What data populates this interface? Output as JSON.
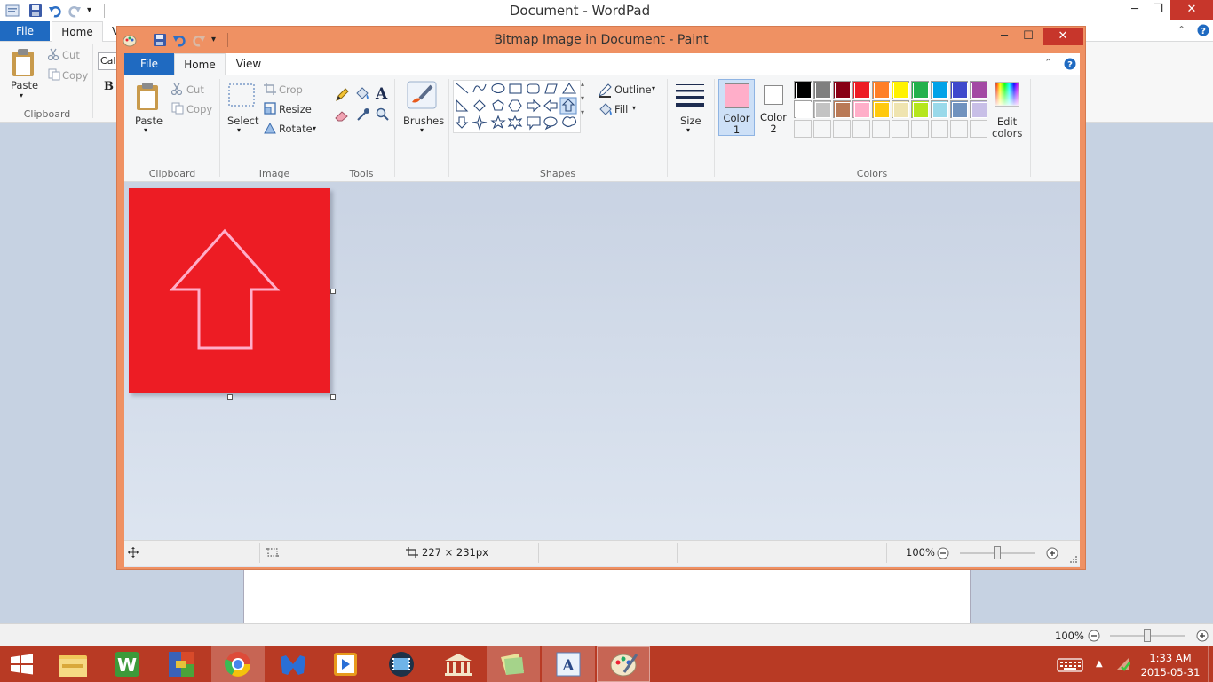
{
  "wordpad": {
    "title": "Document - WordPad",
    "tabs": {
      "file": "File",
      "home": "Home",
      "view_partial": "V"
    },
    "ribbon": {
      "paste": "Paste",
      "cut": "Cut",
      "copy": "Copy",
      "clipboard_group": "Clipboard",
      "font_partial": "Cal",
      "bold": "B"
    },
    "status": {
      "zoom": "100%"
    }
  },
  "paint": {
    "title": "Bitmap Image in Document - Paint",
    "tabs": {
      "file": "File",
      "home": "Home",
      "view": "View"
    },
    "clipboard": {
      "paste": "Paste",
      "cut": "Cut",
      "copy": "Copy",
      "group": "Clipboard"
    },
    "image": {
      "select": "Select",
      "crop": "Crop",
      "resize": "Resize",
      "rotate": "Rotate",
      "group": "Image"
    },
    "tools": {
      "group": "Tools"
    },
    "brushes": {
      "label": "Brushes"
    },
    "shapes": {
      "outline": "Outline",
      "fill": "Fill",
      "group": "Shapes"
    },
    "size": {
      "label": "Size"
    },
    "colors": {
      "color1_line1": "Color",
      "color1_line2": "1",
      "color2_line1": "Color",
      "color2_line2": "2",
      "edit_line1": "Edit",
      "edit_line2": "colors",
      "group": "Colors",
      "color1_value": "#ffaec9",
      "color2_value": "#ffffff",
      "palette_row1": [
        "#000000",
        "#7f7f7f",
        "#880015",
        "#ed1c24",
        "#ff7f27",
        "#fff200",
        "#22b14c",
        "#00a2e8",
        "#3f48cc",
        "#a349a4"
      ],
      "palette_row2": [
        "#ffffff",
        "#c3c3c3",
        "#b97a57",
        "#ffaec9",
        "#ffc90e",
        "#efe4b0",
        "#b5e61d",
        "#99d9ea",
        "#7092be",
        "#c8bfe7"
      ]
    },
    "canvas": {
      "image_color": "#ed1c24",
      "arrow_color": "#ffaec9"
    },
    "status": {
      "size": "227 × 231px",
      "zoom": "100%"
    }
  },
  "taskbar": {
    "time": "1:33 AM",
    "date": "2015-05-31"
  }
}
